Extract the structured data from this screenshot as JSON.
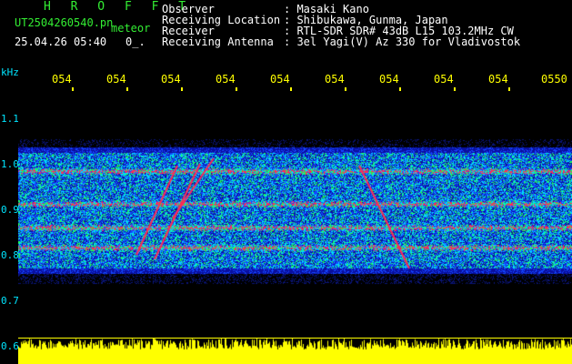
{
  "header": {
    "title": "H R O F F T",
    "filename": "UT2504260540.pn",
    "meteor_tag": "meteor",
    "datetime": "25.04.26 05:40",
    "trail": "0_."
  },
  "info": {
    "observer_label": "Observer",
    "observer_value": ": Masaki Kano",
    "location_label": "Receiving Location",
    "location_value": ": Shibukawa, Gunma, Japan",
    "receiver_label": "Receiver",
    "receiver_value": ": RTL-SDR SDR# 43dB L15 103.2MHz CW",
    "antenna_label": "Receiving Antenna",
    "antenna_value": ": 3el Yagi(V) Az 330 for Vladivostok"
  },
  "axis": {
    "y_unit": "kHz",
    "y_ticks": [
      "1.1",
      "1.0",
      "0.9",
      "0.8",
      "0.7",
      "0.6"
    ],
    "x_ticks": [
      "054",
      "054",
      "054",
      "054",
      "054",
      "054",
      "054",
      "054",
      "054",
      "0550"
    ]
  },
  "colors": {
    "background": "#000000",
    "text_green": "#33ee33",
    "text_white": "#ffffff",
    "axis_yellow": "#ffff00",
    "axis_cyan": "#00e5ff",
    "signal_red": "#ff2a55",
    "noise_blue": "#1a3cff"
  }
}
